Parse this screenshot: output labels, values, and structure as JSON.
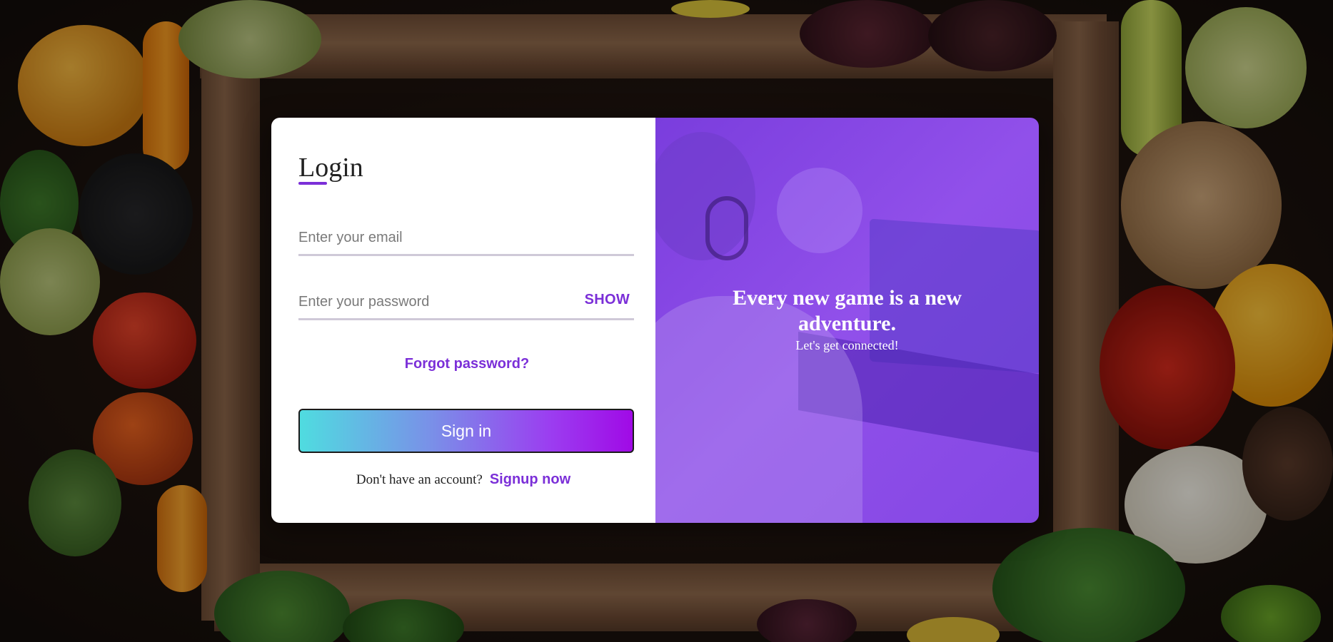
{
  "login": {
    "title": "Login",
    "email_placeholder": "Enter your email",
    "password_placeholder": "Enter your password",
    "show_label": "SHOW",
    "forgot_label": "Forgot password?",
    "signin_label": "Sign in",
    "signup_prompt": "Don't have an account?",
    "signup_label": "Signup now"
  },
  "promo": {
    "headline": "Every new game is a new adventure.",
    "tagline": "Let's get connected!"
  },
  "colors": {
    "accent": "#7b2fd8",
    "button_gradient_start": "#4fdce0",
    "button_gradient_end": "#a00ae6",
    "promo_overlay": "#8447e4"
  }
}
